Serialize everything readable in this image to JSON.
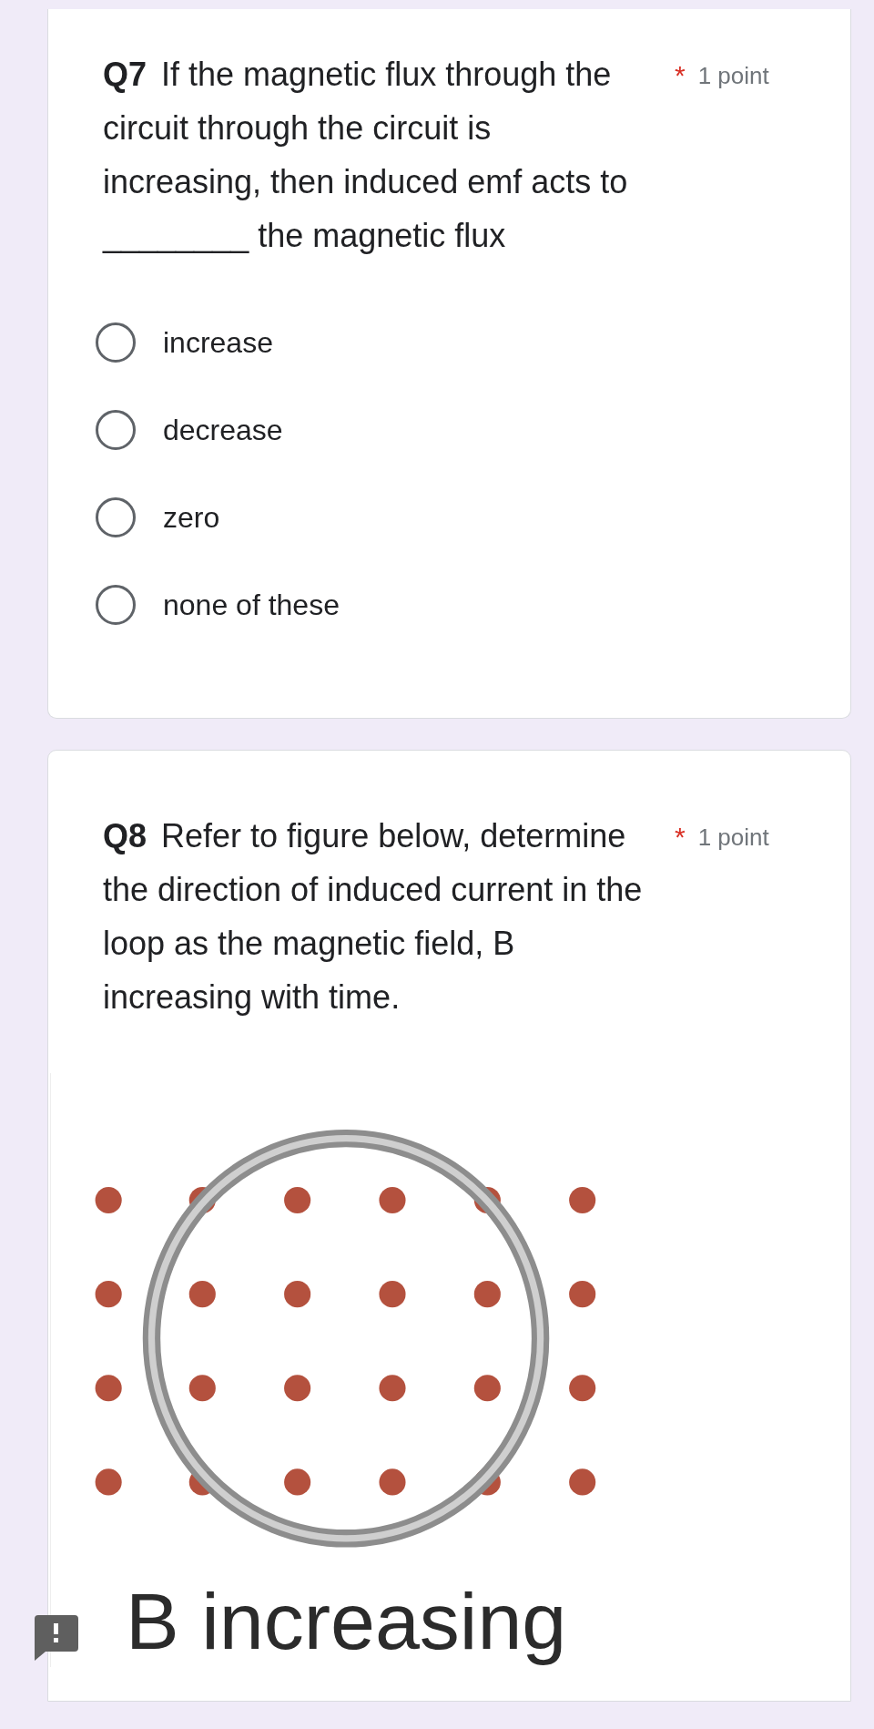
{
  "questions": [
    {
      "number": "Q7",
      "text": "If the magnetic flux through the circuit through the circuit is increasing, then induced emf acts to ________ the magnetic flux",
      "required_mark": "*",
      "points": "1 point",
      "options": [
        {
          "label": "increase",
          "selected": false
        },
        {
          "label": "decrease",
          "selected": false
        },
        {
          "label": "zero",
          "selected": false
        },
        {
          "label": "none of these",
          "selected": false
        }
      ]
    },
    {
      "number": "Q8",
      "text": "Refer to figure below, determine the direction of induced current in the loop as the magnetic field, B increasing with time.",
      "required_mark": "*",
      "points": "1 point",
      "figure": {
        "caption": "B increasing"
      }
    }
  ]
}
